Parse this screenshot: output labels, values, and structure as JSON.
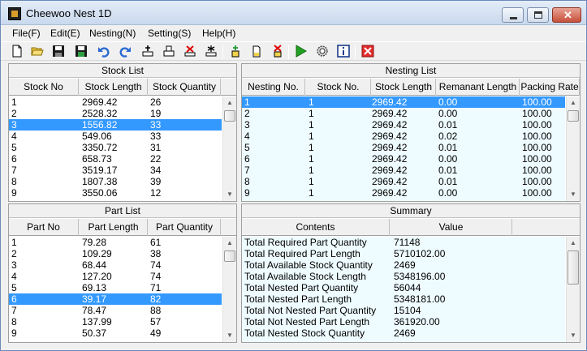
{
  "window": {
    "title": "Cheewoo Nest 1D"
  },
  "menu": [
    "File(F)",
    "Edit(E)",
    "Nesting(N)",
    "Setting(S)",
    "Help(H)"
  ],
  "toolbar": [
    "new-file-icon",
    "open-folder-icon",
    "save-icon",
    "save-as-icon",
    "undo-icon",
    "redo-icon",
    "add-stock-icon",
    "print-stock-icon",
    "delete-stock-icon",
    "clear-stock-icon",
    "add-part-icon",
    "new-part-icon",
    "delete-part-icon",
    "run-nesting-icon",
    "settings-gear-icon",
    "info-icon",
    "exit-icon"
  ],
  "stock_list": {
    "title": "Stock List",
    "headers": [
      "Stock No",
      "Stock Length",
      "Stock Quantity"
    ],
    "rows": [
      [
        "1",
        "2969.42",
        "26"
      ],
      [
        "2",
        "2528.32",
        "19"
      ],
      [
        "3",
        "1556.82",
        "33"
      ],
      [
        "4",
        "549.06",
        "33"
      ],
      [
        "5",
        "3350.72",
        "31"
      ],
      [
        "6",
        "658.73",
        "22"
      ],
      [
        "7",
        "3519.17",
        "34"
      ],
      [
        "8",
        "1807.38",
        "39"
      ],
      [
        "9",
        "3550.06",
        "12"
      ]
    ],
    "selected_index": 2
  },
  "nesting_list": {
    "title": "Nesting List",
    "headers": [
      "Nesting No.",
      "Stock No.",
      "Stock Length",
      "Remanant Length",
      "Packing Rate"
    ],
    "rows": [
      [
        "1",
        "1",
        "2969.42",
        "0.00",
        "100.00"
      ],
      [
        "2",
        "1",
        "2969.42",
        "0.00",
        "100.00"
      ],
      [
        "3",
        "1",
        "2969.42",
        "0.01",
        "100.00"
      ],
      [
        "4",
        "1",
        "2969.42",
        "0.02",
        "100.00"
      ],
      [
        "5",
        "1",
        "2969.42",
        "0.01",
        "100.00"
      ],
      [
        "6",
        "1",
        "2969.42",
        "0.00",
        "100.00"
      ],
      [
        "7",
        "1",
        "2969.42",
        "0.01",
        "100.00"
      ],
      [
        "8",
        "1",
        "2969.42",
        "0.01",
        "100.00"
      ],
      [
        "9",
        "1",
        "2969.42",
        "0.00",
        "100.00"
      ]
    ],
    "selected_index": 0
  },
  "part_list": {
    "title": "Part List",
    "headers": [
      "Part No",
      "Part Length",
      "Part Quantity"
    ],
    "rows": [
      [
        "1",
        "79.28",
        "61"
      ],
      [
        "2",
        "109.29",
        "38"
      ],
      [
        "3",
        "68.44",
        "74"
      ],
      [
        "4",
        "127.20",
        "74"
      ],
      [
        "5",
        "69.13",
        "71"
      ],
      [
        "6",
        "39.17",
        "82"
      ],
      [
        "7",
        "78.47",
        "88"
      ],
      [
        "8",
        "137.99",
        "57"
      ],
      [
        "9",
        "50.37",
        "49"
      ]
    ],
    "selected_index": 5
  },
  "summary": {
    "title": "Summary",
    "headers": [
      "Contents",
      "Value"
    ],
    "rows": [
      [
        "Total Required Part Quantity",
        "71148"
      ],
      [
        "Total Required Part Length",
        "5710102.00"
      ],
      [
        "Total Available Stock Quantity",
        "2469"
      ],
      [
        "Total Available Stock Length",
        "5348196.00"
      ],
      [
        "Total Nested Part Quantity",
        "56044"
      ],
      [
        "Total Nested Part Length",
        "5348181.00"
      ],
      [
        "Total Not Nested Part Quantity",
        "15104"
      ],
      [
        "Total Not Nested Part Length",
        "361920.00"
      ],
      [
        "Total Nested Stock Quantity",
        "2469"
      ]
    ]
  },
  "colors": {
    "selection": "#3399ff",
    "nesting_bg": "#eefbff"
  }
}
